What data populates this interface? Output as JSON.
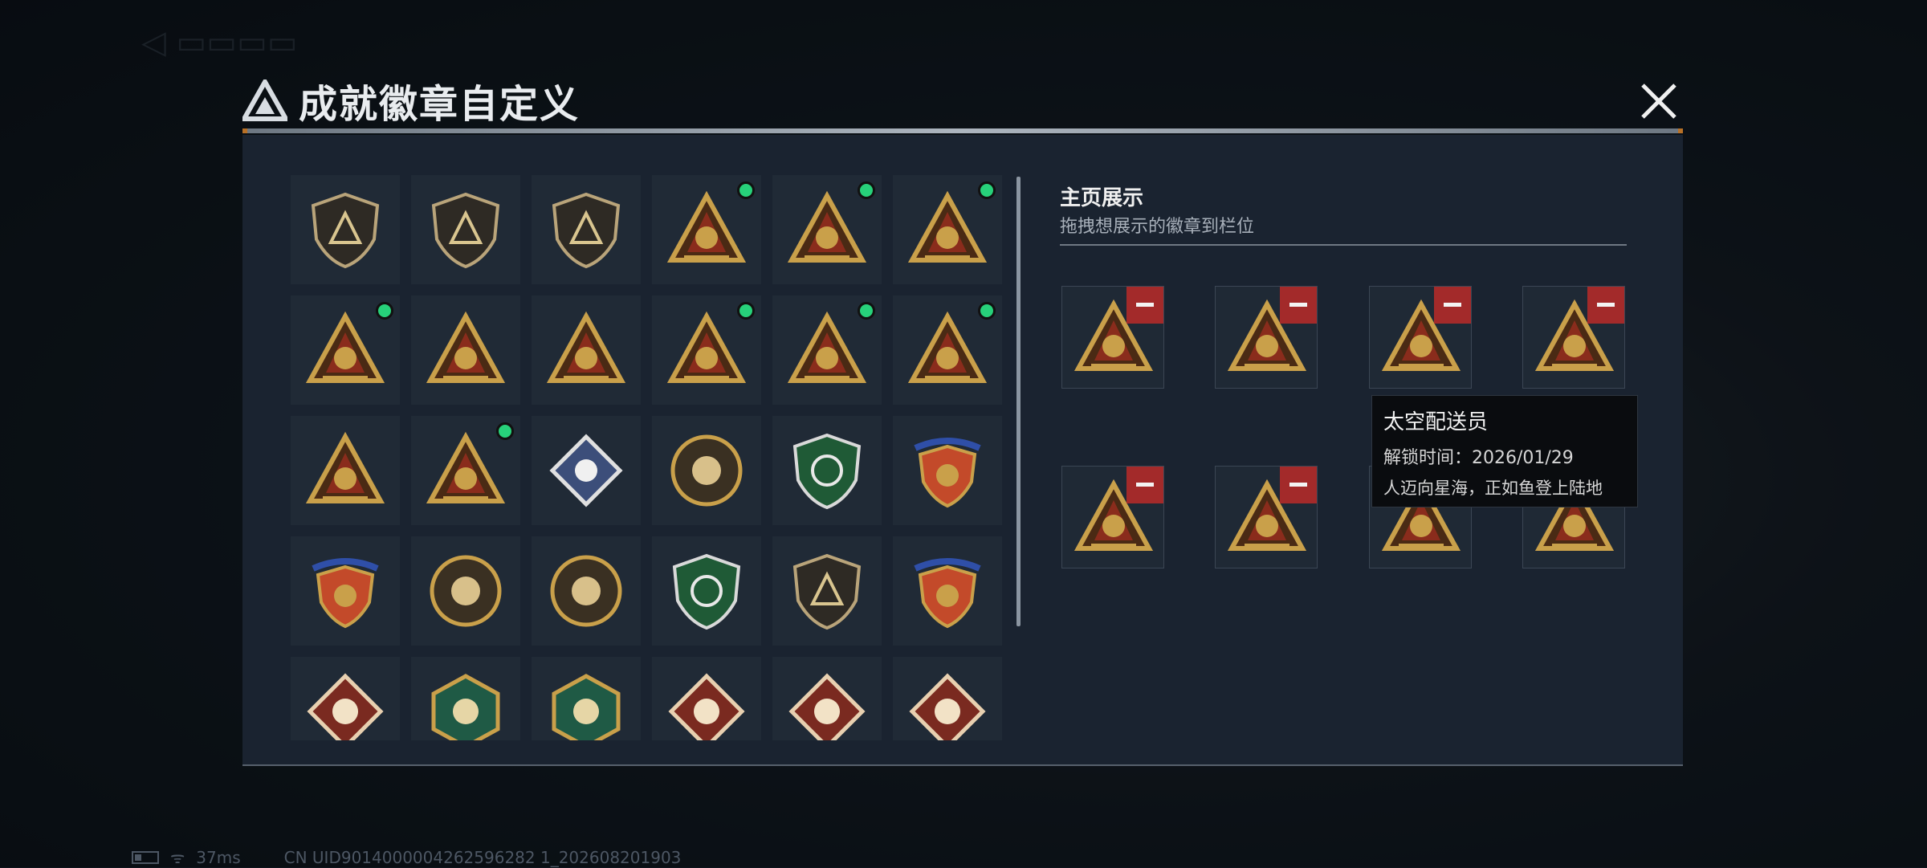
{
  "dialog": {
    "title": "成就徽章自定义",
    "close_icon": "close-icon"
  },
  "showcase": {
    "title": "主页展示",
    "subtitle": "拖拽想展示的徽章到栏位"
  },
  "tooltip": {
    "name": "太空配送员",
    "unlock_time": "解锁时间：2026/01/29",
    "description": "人迈向星海，正如鱼登上陆地"
  },
  "status_bar": {
    "ping": "37ms",
    "uid": "CN UID9014000004262596282 1_202608201903"
  },
  "colors": {
    "accent_orange": "#d7822a",
    "selected_dot": "#27d17a",
    "remove_red": "#a32a2a",
    "gold": "#c9a04a"
  },
  "badges": [
    {
      "icon": "alliance-shield-badge-icon",
      "selected": false
    },
    {
      "icon": "helicopter-shield-badge-icon",
      "selected": false
    },
    {
      "icon": "daggers-shield-badge-icon",
      "selected": false
    },
    {
      "icon": "backpack-triangle-badge-icon",
      "selected": true
    },
    {
      "icon": "vest-56-triangle-badge-icon",
      "selected": true
    },
    {
      "icon": "crate-triangle-badge-icon",
      "selected": true
    },
    {
      "icon": "drink-58-triangle-badge-icon",
      "selected": true
    },
    {
      "icon": "bird-triangle-badge-icon",
      "selected": false
    },
    {
      "icon": "number-one-triangle-badge-icon",
      "selected": false
    },
    {
      "icon": "usb-triangle-badge-icon",
      "selected": true
    },
    {
      "icon": "runner-triangle-badge-icon",
      "selected": true
    },
    {
      "icon": "gem-triangle-badge-icon",
      "selected": true
    },
    {
      "icon": "soldiers-triangle-badge-icon",
      "selected": false
    },
    {
      "icon": "rocket-triangle-badge-icon",
      "selected": true
    },
    {
      "icon": "rose-diamond-badge-icon",
      "selected": false
    },
    {
      "icon": "star-round-badge-icon",
      "selected": false
    },
    {
      "icon": "green-shield-badge-icon",
      "selected": false
    },
    {
      "icon": "winged-shield-badge-icon",
      "selected": false
    },
    {
      "icon": "diamond-shield-badge-icon",
      "selected": false
    },
    {
      "icon": "skull-round-badge-icon",
      "selected": false
    },
    {
      "icon": "beast-round-badge-icon",
      "selected": false
    },
    {
      "icon": "crosshair-shield-badge-icon",
      "selected": false
    },
    {
      "icon": "rifle-shield-badge-icon",
      "selected": false
    },
    {
      "icon": "swords-crest-badge-icon",
      "selected": false
    },
    {
      "icon": "wolf-diamond-badge-icon",
      "selected": false
    },
    {
      "icon": "dragon-hexagon-badge-icon",
      "selected": false
    },
    {
      "icon": "fighter-hexagon-badge-icon",
      "selected": false
    },
    {
      "icon": "dragon-diamond-badge-icon",
      "selected": false
    },
    {
      "icon": "dragon-red-diamond-badge-icon",
      "selected": false
    },
    {
      "icon": "runner-diamond-badge-icon",
      "selected": false
    }
  ],
  "slots": [
    {
      "icon": "runner-triangle-badge-icon"
    },
    {
      "icon": "usb-triangle-badge-icon"
    },
    {
      "icon": "rocket-triangle-badge-icon"
    },
    {
      "icon": "gem-triangle-badge-icon"
    },
    {
      "icon": "backpack-triangle-badge-icon"
    },
    {
      "icon": "vest-56-triangle-badge-icon"
    },
    {
      "icon": "crate-triangle-badge-icon"
    },
    {
      "icon": "drink-58-triangle-badge-icon"
    }
  ]
}
